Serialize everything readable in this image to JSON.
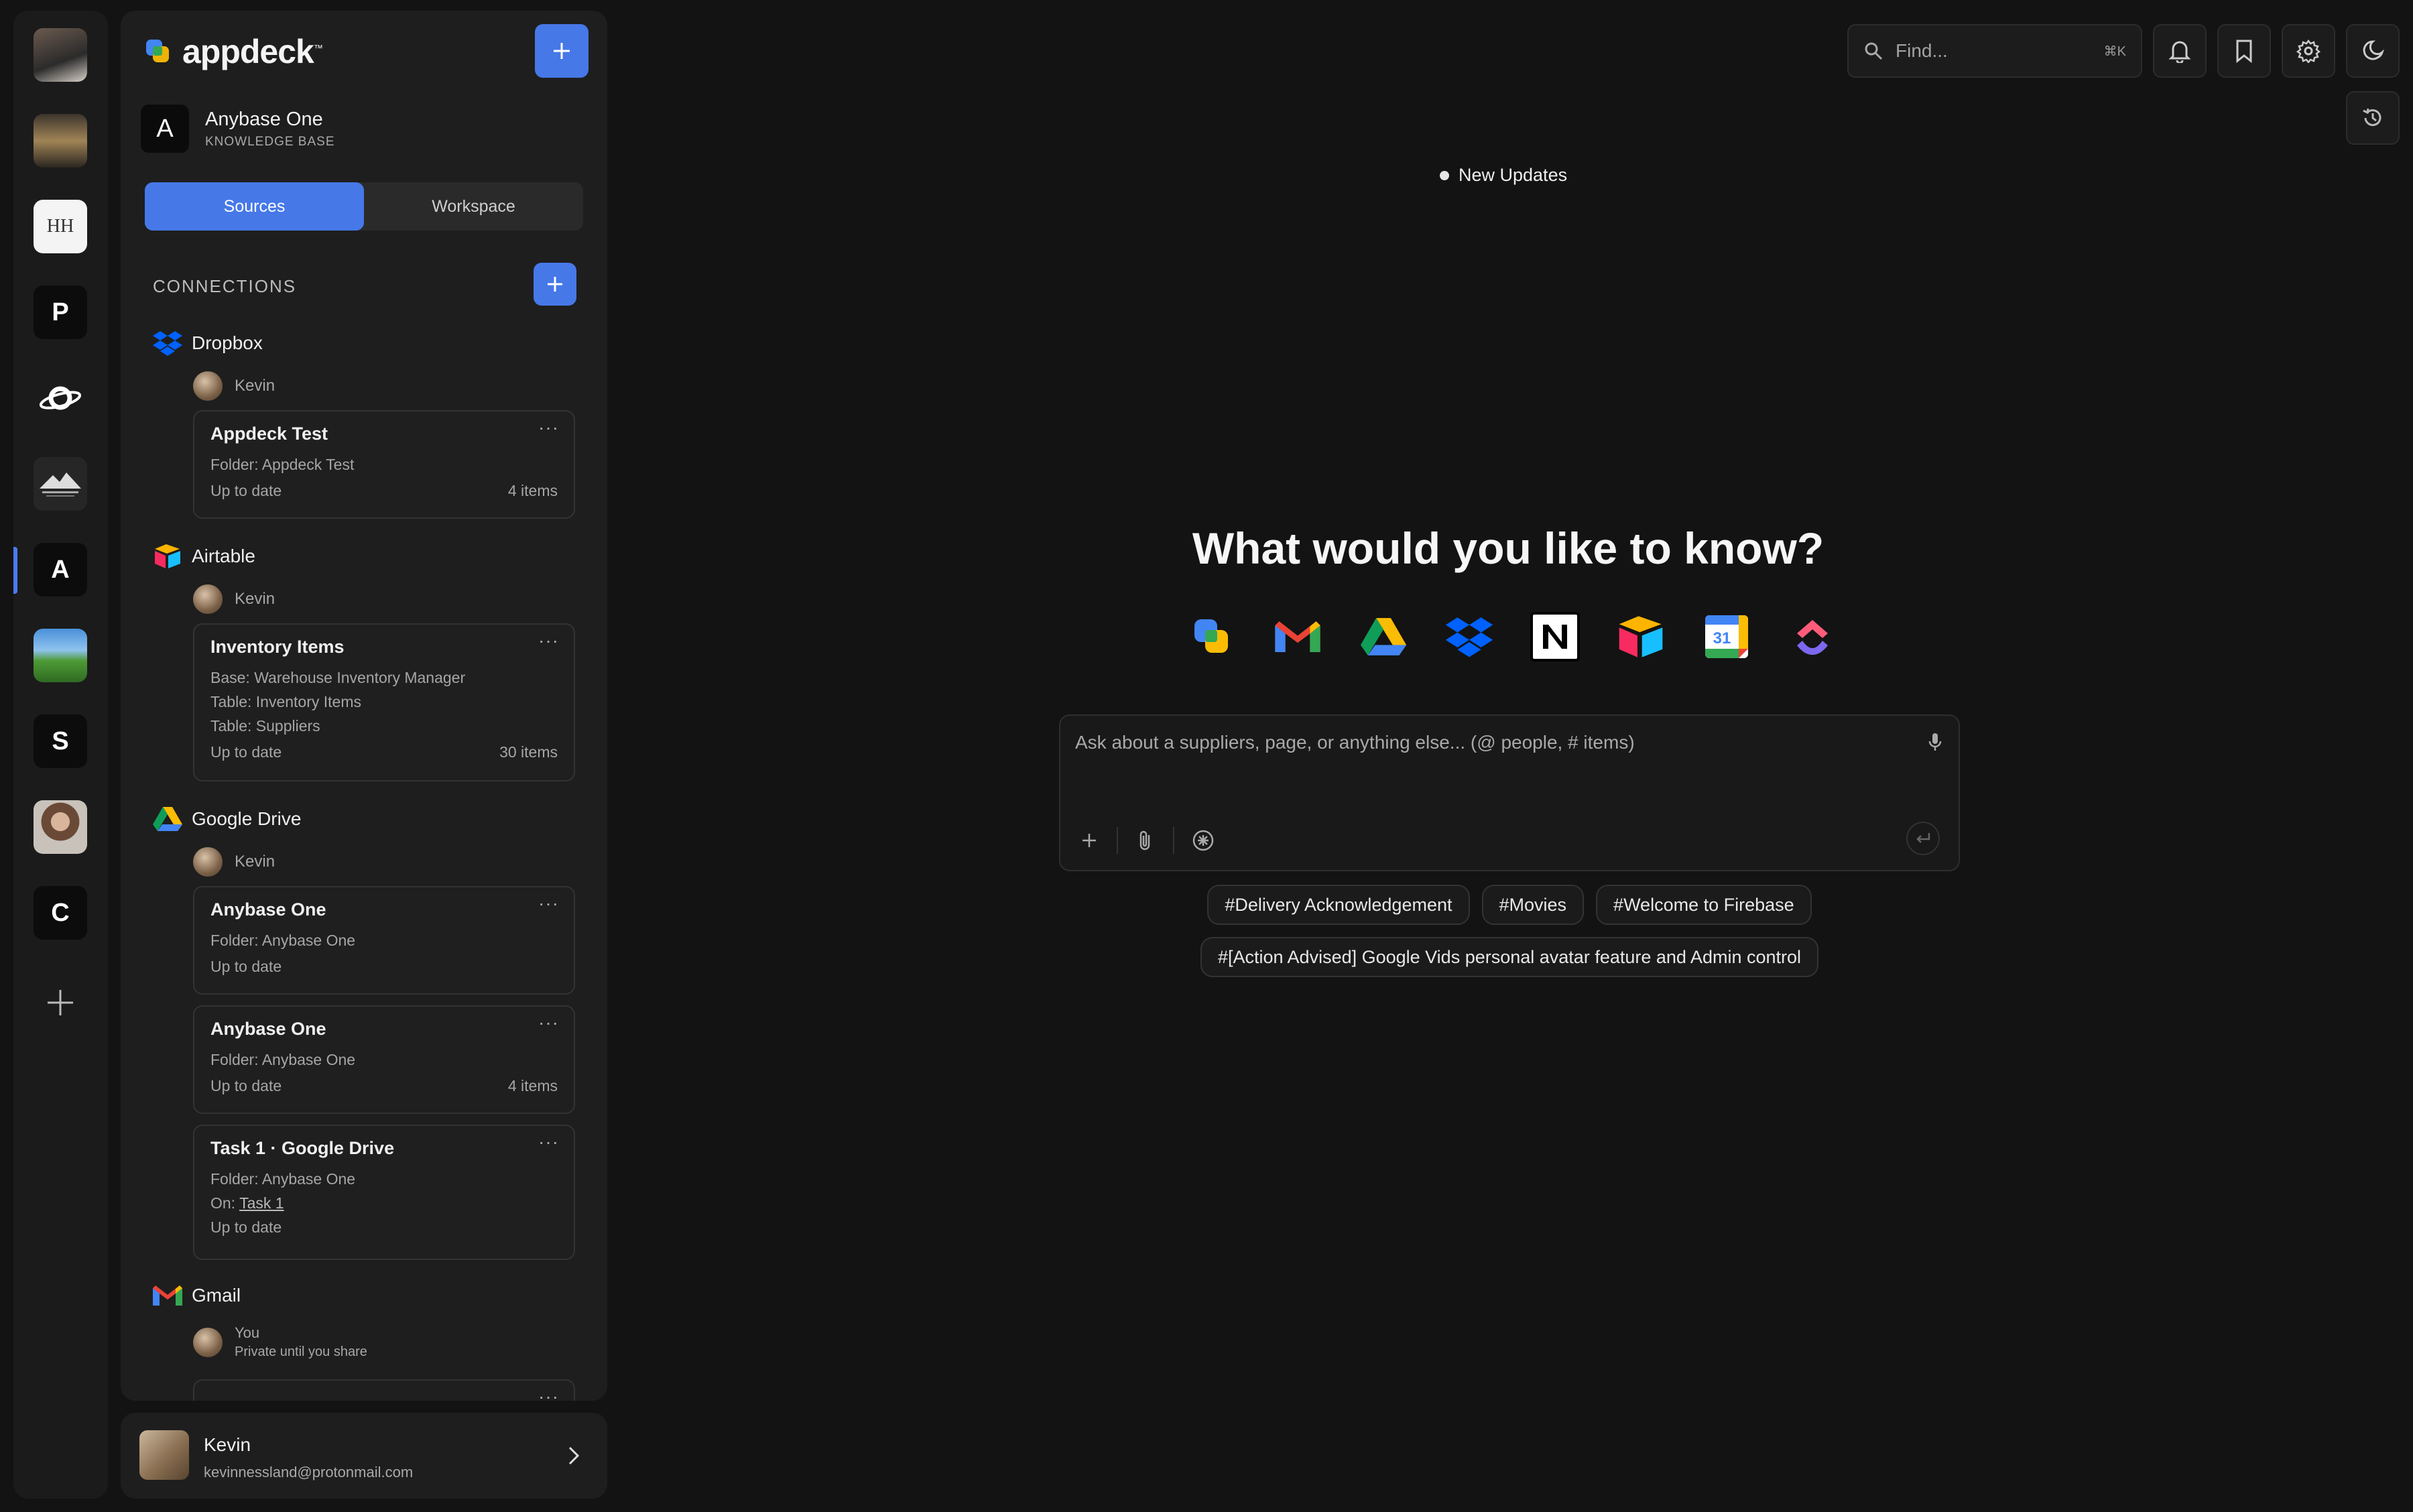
{
  "rail": {
    "workspaces": [
      {
        "kind": "photo",
        "name": "workspace-avatar-man",
        "bg": "#3a3a3a"
      },
      {
        "kind": "photo",
        "name": "workspace-avatar-room",
        "bg": "#54493c"
      },
      {
        "kind": "logo",
        "name": "workspace-hh-logo",
        "text": "HH"
      },
      {
        "kind": "letter",
        "name": "workspace-p",
        "text": "P"
      },
      {
        "kind": "logo",
        "name": "workspace-planet-logo",
        "text": ""
      },
      {
        "kind": "logo",
        "name": "workspace-mountain-logo",
        "text": ""
      },
      {
        "kind": "letter",
        "name": "workspace-a",
        "text": "A",
        "active": true
      },
      {
        "kind": "photo",
        "name": "workspace-avatar-landscape",
        "bg": "#4e8a3c"
      },
      {
        "kind": "letter",
        "name": "workspace-s",
        "text": "S"
      },
      {
        "kind": "photo",
        "name": "workspace-avatar-woman",
        "bg": "#8b6e5a"
      },
      {
        "kind": "letter",
        "name": "workspace-c",
        "text": "C"
      }
    ]
  },
  "brand": {
    "name": "appdeck",
    "tm": "™"
  },
  "knowledge_base": {
    "initial": "A",
    "title": "Anybase One",
    "subtitle": "KNOWLEDGE BASE"
  },
  "tabs": {
    "sources": "Sources",
    "workspace": "Workspace"
  },
  "connections_heading": "CONNECTIONS",
  "sources": [
    {
      "name": "Dropbox",
      "owner": "Kevin",
      "cards": [
        {
          "title": "Appdeck Test",
          "lines": [
            "Folder: Appdeck Test"
          ],
          "status": "Up to date",
          "count": "4 items"
        }
      ]
    },
    {
      "name": "Airtable",
      "owner": "Kevin",
      "cards": [
        {
          "title": "Inventory Items",
          "lines": [
            "Base: Warehouse Inventory Manager",
            "Table: Inventory Items",
            "Table: Suppliers"
          ],
          "status": "Up to date",
          "count": "30 items"
        }
      ]
    },
    {
      "name": "Google Drive",
      "owner": "Kevin",
      "cards": [
        {
          "title": "Anybase One",
          "lines": [
            "Folder: Anybase One"
          ],
          "status": "Up to date",
          "count": ""
        },
        {
          "title": "Anybase One",
          "lines": [
            "Folder: Anybase One"
          ],
          "status": "Up to date",
          "count": "4 items"
        },
        {
          "title": "Task 1 · Google Drive",
          "lines": [
            "Folder: Anybase One"
          ],
          "on_label": "On:",
          "on_link": "Task 1",
          "status": "Up to date",
          "count": ""
        }
      ]
    },
    {
      "name": "Gmail",
      "owner": "You",
      "owner_note": "Private until you share"
    }
  ],
  "card_more": "···",
  "profile": {
    "name": "Kevin",
    "email": "kevinnessland@protonmail.com"
  },
  "search": {
    "placeholder": "Find...",
    "shortcut": "⌘K"
  },
  "updates": "New Updates",
  "hero": "What would you like to know?",
  "app_icons": [
    "appdeck-icon",
    "gmail-icon",
    "google-drive-icon",
    "dropbox-icon",
    "notion-icon",
    "airtable-icon",
    "google-calendar-icon",
    "clickup-icon"
  ],
  "calendar_day": "31",
  "ask": {
    "placeholder": "Ask about a suppliers, page, or anything else... (@ people, # items)"
  },
  "suggestions": [
    "#Delivery Acknowledgement",
    "#Movies",
    "#Welcome to Firebase",
    "#[Action Advised] Google Vids personal avatar feature and Admin control"
  ],
  "colors": {
    "accent": "#4678e8",
    "bg": "#131313",
    "panel": "#1e1e1e"
  }
}
